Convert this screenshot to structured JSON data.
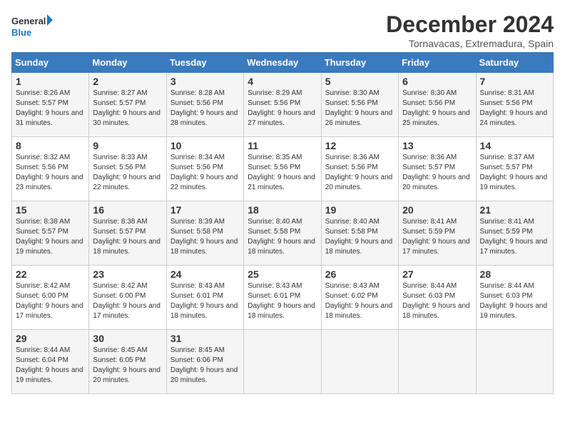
{
  "logo": {
    "line1": "General",
    "line2": "Blue"
  },
  "title": "December 2024",
  "subtitle": "Tornavacas, Extremadura, Spain",
  "days_of_week": [
    "Sunday",
    "Monday",
    "Tuesday",
    "Wednesday",
    "Thursday",
    "Friday",
    "Saturday"
  ],
  "weeks": [
    [
      {
        "day": "1",
        "sunrise": "Sunrise: 8:26 AM",
        "sunset": "Sunset: 5:57 PM",
        "daylight": "Daylight: 9 hours and 31 minutes."
      },
      {
        "day": "2",
        "sunrise": "Sunrise: 8:27 AM",
        "sunset": "Sunset: 5:57 PM",
        "daylight": "Daylight: 9 hours and 30 minutes."
      },
      {
        "day": "3",
        "sunrise": "Sunrise: 8:28 AM",
        "sunset": "Sunset: 5:56 PM",
        "daylight": "Daylight: 9 hours and 28 minutes."
      },
      {
        "day": "4",
        "sunrise": "Sunrise: 8:29 AM",
        "sunset": "Sunset: 5:56 PM",
        "daylight": "Daylight: 9 hours and 27 minutes."
      },
      {
        "day": "5",
        "sunrise": "Sunrise: 8:30 AM",
        "sunset": "Sunset: 5:56 PM",
        "daylight": "Daylight: 9 hours and 26 minutes."
      },
      {
        "day": "6",
        "sunrise": "Sunrise: 8:30 AM",
        "sunset": "Sunset: 5:56 PM",
        "daylight": "Daylight: 9 hours and 25 minutes."
      },
      {
        "day": "7",
        "sunrise": "Sunrise: 8:31 AM",
        "sunset": "Sunset: 5:56 PM",
        "daylight": "Daylight: 9 hours and 24 minutes."
      }
    ],
    [
      {
        "day": "8",
        "sunrise": "Sunrise: 8:32 AM",
        "sunset": "Sunset: 5:56 PM",
        "daylight": "Daylight: 9 hours and 23 minutes."
      },
      {
        "day": "9",
        "sunrise": "Sunrise: 8:33 AM",
        "sunset": "Sunset: 5:56 PM",
        "daylight": "Daylight: 9 hours and 22 minutes."
      },
      {
        "day": "10",
        "sunrise": "Sunrise: 8:34 AM",
        "sunset": "Sunset: 5:56 PM",
        "daylight": "Daylight: 9 hours and 22 minutes."
      },
      {
        "day": "11",
        "sunrise": "Sunrise: 8:35 AM",
        "sunset": "Sunset: 5:56 PM",
        "daylight": "Daylight: 9 hours and 21 minutes."
      },
      {
        "day": "12",
        "sunrise": "Sunrise: 8:36 AM",
        "sunset": "Sunset: 5:56 PM",
        "daylight": "Daylight: 9 hours and 20 minutes."
      },
      {
        "day": "13",
        "sunrise": "Sunrise: 8:36 AM",
        "sunset": "Sunset: 5:57 PM",
        "daylight": "Daylight: 9 hours and 20 minutes."
      },
      {
        "day": "14",
        "sunrise": "Sunrise: 8:37 AM",
        "sunset": "Sunset: 5:57 PM",
        "daylight": "Daylight: 9 hours and 19 minutes."
      }
    ],
    [
      {
        "day": "15",
        "sunrise": "Sunrise: 8:38 AM",
        "sunset": "Sunset: 5:57 PM",
        "daylight": "Daylight: 9 hours and 19 minutes."
      },
      {
        "day": "16",
        "sunrise": "Sunrise: 8:38 AM",
        "sunset": "Sunset: 5:57 PM",
        "daylight": "Daylight: 9 hours and 18 minutes."
      },
      {
        "day": "17",
        "sunrise": "Sunrise: 8:39 AM",
        "sunset": "Sunset: 5:58 PM",
        "daylight": "Daylight: 9 hours and 18 minutes."
      },
      {
        "day": "18",
        "sunrise": "Sunrise: 8:40 AM",
        "sunset": "Sunset: 5:58 PM",
        "daylight": "Daylight: 9 hours and 18 minutes."
      },
      {
        "day": "19",
        "sunrise": "Sunrise: 8:40 AM",
        "sunset": "Sunset: 5:58 PM",
        "daylight": "Daylight: 9 hours and 18 minutes."
      },
      {
        "day": "20",
        "sunrise": "Sunrise: 8:41 AM",
        "sunset": "Sunset: 5:59 PM",
        "daylight": "Daylight: 9 hours and 17 minutes."
      },
      {
        "day": "21",
        "sunrise": "Sunrise: 8:41 AM",
        "sunset": "Sunset: 5:59 PM",
        "daylight": "Daylight: 9 hours and 17 minutes."
      }
    ],
    [
      {
        "day": "22",
        "sunrise": "Sunrise: 8:42 AM",
        "sunset": "Sunset: 6:00 PM",
        "daylight": "Daylight: 9 hours and 17 minutes."
      },
      {
        "day": "23",
        "sunrise": "Sunrise: 8:42 AM",
        "sunset": "Sunset: 6:00 PM",
        "daylight": "Daylight: 9 hours and 17 minutes."
      },
      {
        "day": "24",
        "sunrise": "Sunrise: 8:43 AM",
        "sunset": "Sunset: 6:01 PM",
        "daylight": "Daylight: 9 hours and 18 minutes."
      },
      {
        "day": "25",
        "sunrise": "Sunrise: 8:43 AM",
        "sunset": "Sunset: 6:01 PM",
        "daylight": "Daylight: 9 hours and 18 minutes."
      },
      {
        "day": "26",
        "sunrise": "Sunrise: 8:43 AM",
        "sunset": "Sunset: 6:02 PM",
        "daylight": "Daylight: 9 hours and 18 minutes."
      },
      {
        "day": "27",
        "sunrise": "Sunrise: 8:44 AM",
        "sunset": "Sunset: 6:03 PM",
        "daylight": "Daylight: 9 hours and 18 minutes."
      },
      {
        "day": "28",
        "sunrise": "Sunrise: 8:44 AM",
        "sunset": "Sunset: 6:03 PM",
        "daylight": "Daylight: 9 hours and 19 minutes."
      }
    ],
    [
      {
        "day": "29",
        "sunrise": "Sunrise: 8:44 AM",
        "sunset": "Sunset: 6:04 PM",
        "daylight": "Daylight: 9 hours and 19 minutes."
      },
      {
        "day": "30",
        "sunrise": "Sunrise: 8:45 AM",
        "sunset": "Sunset: 6:05 PM",
        "daylight": "Daylight: 9 hours and 20 minutes."
      },
      {
        "day": "31",
        "sunrise": "Sunrise: 8:45 AM",
        "sunset": "Sunset: 6:06 PM",
        "daylight": "Daylight: 9 hours and 20 minutes."
      },
      null,
      null,
      null,
      null
    ]
  ]
}
